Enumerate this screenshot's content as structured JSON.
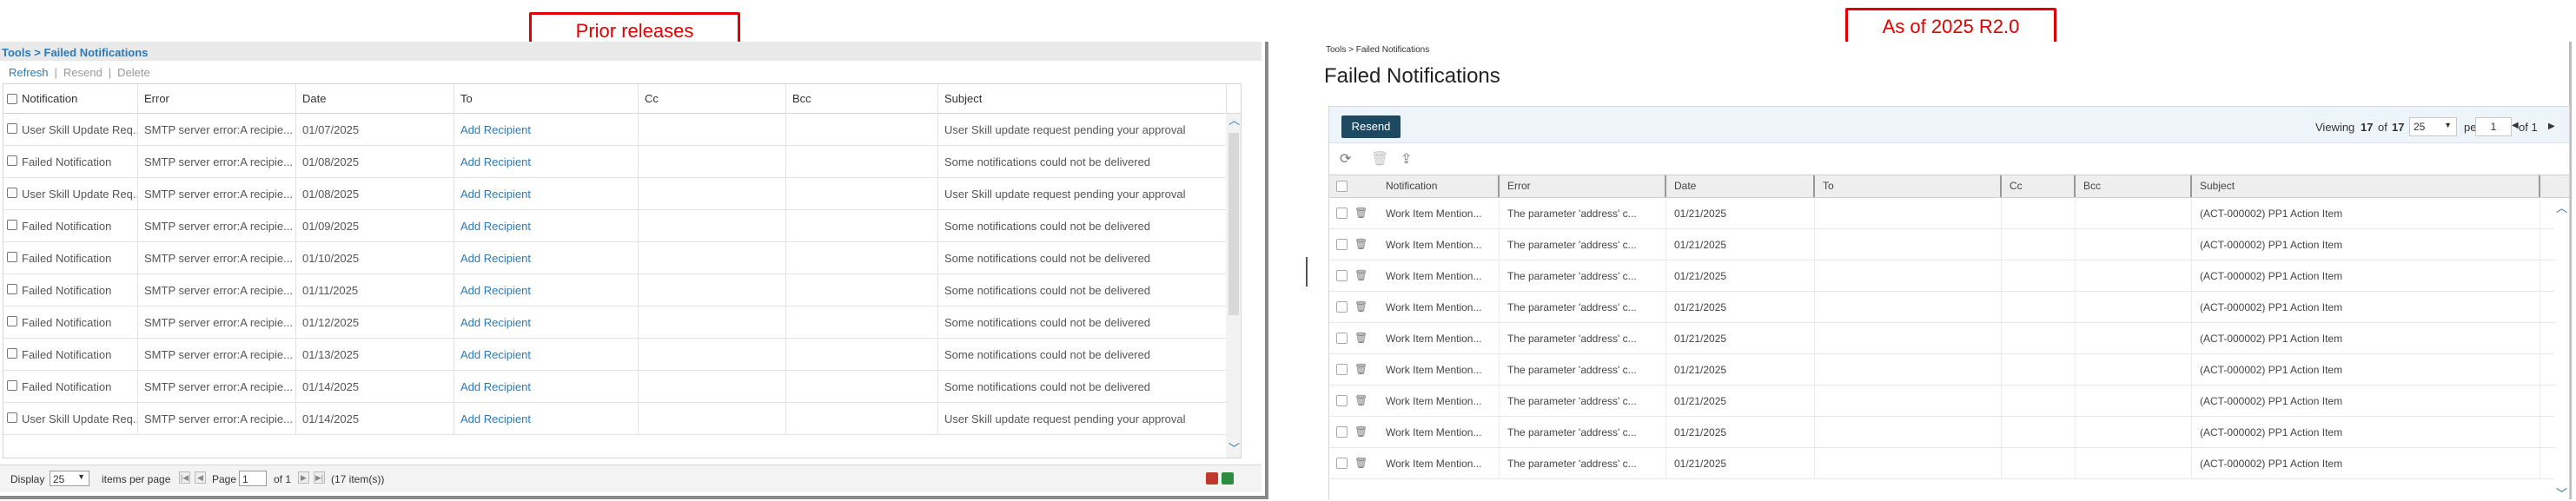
{
  "callouts": {
    "left": "Prior releases",
    "right": "As of 2025 R2.0"
  },
  "legacy": {
    "breadcrumb": "Tools > Failed Notifications",
    "actions": {
      "refresh": "Refresh",
      "sep1": "|",
      "resend": "Resend",
      "sep2": "|",
      "delete": "Delete"
    },
    "columns": [
      "Notification",
      "Error",
      "Date",
      "To",
      "Cc",
      "Bcc",
      "Subject"
    ],
    "rows": [
      {
        "notification": "User Skill Update Req...",
        "error": "SMTP server error:A recipie...",
        "date": "01/07/2025",
        "to": "Add Recipient",
        "subject": "User Skill update request pending your approval"
      },
      {
        "notification": "Failed Notification",
        "error": "SMTP server error:A recipie...",
        "date": "01/08/2025",
        "to": "Add Recipient",
        "subject": "Some notifications could not be delivered"
      },
      {
        "notification": "User Skill Update Req...",
        "error": "SMTP server error:A recipie...",
        "date": "01/08/2025",
        "to": "Add Recipient",
        "subject": "User Skill update request pending your approval"
      },
      {
        "notification": "Failed Notification",
        "error": "SMTP server error:A recipie...",
        "date": "01/09/2025",
        "to": "Add Recipient",
        "subject": "Some notifications could not be delivered"
      },
      {
        "notification": "Failed Notification",
        "error": "SMTP server error:A recipie...",
        "date": "01/10/2025",
        "to": "Add Recipient",
        "subject": "Some notifications could not be delivered"
      },
      {
        "notification": "Failed Notification",
        "error": "SMTP server error:A recipie...",
        "date": "01/11/2025",
        "to": "Add Recipient",
        "subject": "Some notifications could not be delivered"
      },
      {
        "notification": "Failed Notification",
        "error": "SMTP server error:A recipie...",
        "date": "01/12/2025",
        "to": "Add Recipient",
        "subject": "Some notifications could not be delivered"
      },
      {
        "notification": "Failed Notification",
        "error": "SMTP server error:A recipie...",
        "date": "01/13/2025",
        "to": "Add Recipient",
        "subject": "Some notifications could not be delivered"
      },
      {
        "notification": "Failed Notification",
        "error": "SMTP server error:A recipie...",
        "date": "01/14/2025",
        "to": "Add Recipient",
        "subject": "Some notifications could not be delivered"
      },
      {
        "notification": "User Skill Update Req...",
        "error": "SMTP server error:A recipie...",
        "date": "01/14/2025",
        "to": "Add Recipient",
        "subject": "User Skill update request pending your approval"
      }
    ],
    "footer": {
      "display_label": "Display",
      "page_size": "25",
      "items_per_page": "items per page",
      "page_label": "Page",
      "page_value": "1",
      "of_label": "of 1",
      "total": "(17 item(s))"
    }
  },
  "current": {
    "breadcrumb": "Tools > Failed Notifications",
    "title": "Failed Notifications",
    "resend": "Resend",
    "pager": {
      "viewing_prefix": "Viewing",
      "viewing_count": "17",
      "viewing_of": "of",
      "viewing_total": "17",
      "per_page_value": "25",
      "per_page_label": "per page",
      "page_value": "1",
      "of_label": "of 1"
    },
    "columns": [
      "Notification",
      "Error",
      "Date",
      "To",
      "Cc",
      "Bcc",
      "Subject"
    ],
    "rows": [
      {
        "notification": "Work Item Mention...",
        "error": "The parameter 'address' c...",
        "date": "01/21/2025",
        "subject": "(ACT-000002) PP1 Action Item"
      },
      {
        "notification": "Work Item Mention...",
        "error": "The parameter 'address' c...",
        "date": "01/21/2025",
        "subject": "(ACT-000002) PP1 Action Item"
      },
      {
        "notification": "Work Item Mention...",
        "error": "The parameter 'address' c...",
        "date": "01/21/2025",
        "subject": "(ACT-000002) PP1 Action Item"
      },
      {
        "notification": "Work Item Mention...",
        "error": "The parameter 'address' c...",
        "date": "01/21/2025",
        "subject": "(ACT-000002) PP1 Action Item"
      },
      {
        "notification": "Work Item Mention...",
        "error": "The parameter 'address' c...",
        "date": "01/21/2025",
        "subject": "(ACT-000002) PP1 Action Item"
      },
      {
        "notification": "Work Item Mention...",
        "error": "The parameter 'address' c...",
        "date": "01/21/2025",
        "subject": "(ACT-000002) PP1 Action Item"
      },
      {
        "notification": "Work Item Mention...",
        "error": "The parameter 'address' c...",
        "date": "01/21/2025",
        "subject": "(ACT-000002) PP1 Action Item"
      },
      {
        "notification": "Work Item Mention...",
        "error": "The parameter 'address' c...",
        "date": "01/21/2025",
        "subject": "(ACT-000002) PP1 Action Item"
      },
      {
        "notification": "Work Item Mention...",
        "error": "The parameter 'address' c...",
        "date": "01/21/2025",
        "subject": "(ACT-000002) PP1 Action Item"
      }
    ],
    "icons": [
      "refresh-icon",
      "trash-icon",
      "export-icon"
    ]
  },
  "colors": {
    "callout": "#e00000",
    "link": "#2a7ab8",
    "resend_bg": "#1d4a61",
    "toolbar_bg": "#eef5fa"
  }
}
